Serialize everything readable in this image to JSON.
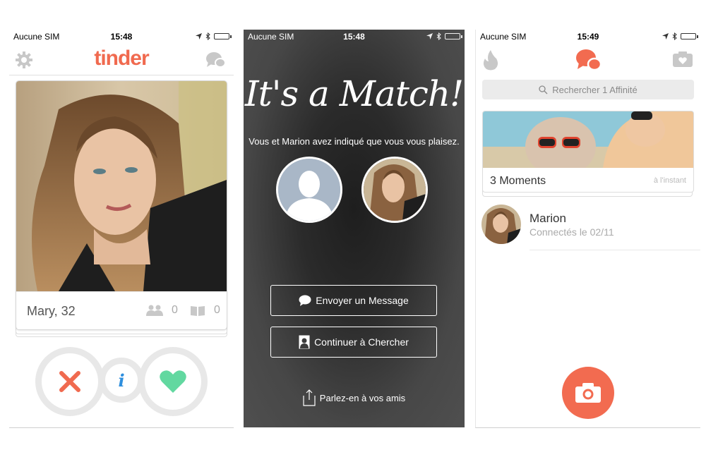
{
  "colors": {
    "accent": "#f06a4f",
    "like": "#62d8a0",
    "info": "#2f8fde"
  },
  "screen1": {
    "status": {
      "carrier": "Aucune SIM",
      "time": "15:48"
    },
    "logo": "tinder",
    "card": {
      "name": "Mary, 32",
      "friends_count": "0",
      "interests_count": "0"
    },
    "icons": [
      "gear-icon",
      "chat-bubbles-icon",
      "friends-icon",
      "book-icon",
      "nope-x-icon",
      "info-icon",
      "heart-icon"
    ]
  },
  "screen2": {
    "status": {
      "carrier": "Aucune SIM",
      "time": "15:48"
    },
    "title": "It's a Match!",
    "subtitle": "Vous et Marion avez indiqué que vous vous plaisez.",
    "message_button": "Envoyer un Message",
    "keep_searching_button": "Continuer à Chercher",
    "share_label": "Parlez-en à vos amis"
  },
  "screen3": {
    "status": {
      "carrier": "Aucune SIM",
      "time": "15:49"
    },
    "search_placeholder": "Rechercher 1 Affinité",
    "moments": {
      "title": "3 Moments",
      "time": "à l'instant"
    },
    "match": {
      "name": "Marion",
      "detail": "Connectés le 02/11"
    }
  }
}
